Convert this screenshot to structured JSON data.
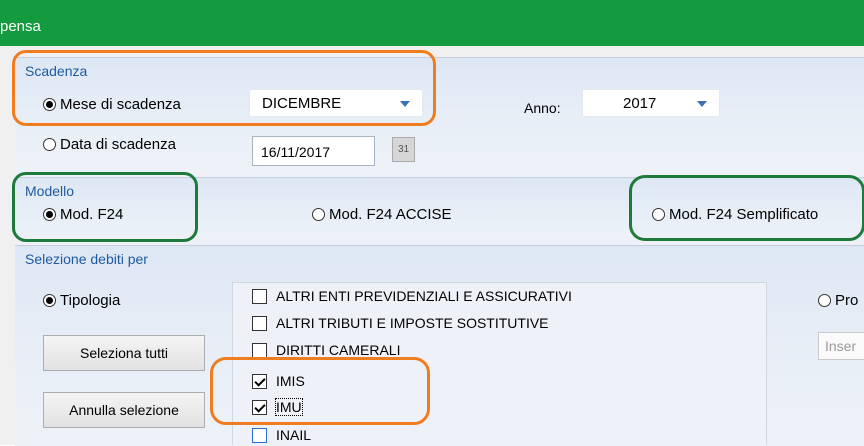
{
  "window": {
    "title": "pensa"
  },
  "scadenza": {
    "header": "Scadenza",
    "mese_label": "Mese di scadenza",
    "mese_value": "DICEMBRE",
    "anno_label": "Anno:",
    "anno_value": "2017",
    "data_label": "Data di scadenza",
    "data_value": "16/11/2017",
    "calendar_text": "31",
    "selected": "mese"
  },
  "modello": {
    "header": "Modello",
    "options": [
      "Mod. F24",
      "Mod. F24 ACCISE",
      "Mod. F24 Semplificato"
    ],
    "selected_index": 0
  },
  "selezione": {
    "header": "Selezione debiti per",
    "tipologia_label": "Tipologia",
    "pro_label": "Pro",
    "select_all_label": "Seleziona tutti",
    "clear_label": "Annulla selezione",
    "input_placeholder": "Inser",
    "items": [
      {
        "label": "ALTRI ENTI PREVIDENZIALI E ASSICURATIVI",
        "checked": false
      },
      {
        "label": "ALTRI TRIBUTI E IMPOSTE SOSTITUTIVE",
        "checked": false
      },
      {
        "label": "DIRITTI CAMERALI",
        "checked": false
      },
      {
        "label": "IMIS",
        "checked": true
      },
      {
        "label": "IMU",
        "checked": true
      },
      {
        "label": "INAIL",
        "checked": false
      }
    ]
  },
  "colors": {
    "titlebar": "#149a3f",
    "orange_highlight": "#ef7d1f",
    "green_highlight": "#1e7a3a",
    "group_header_text": "#1e5a9e"
  }
}
